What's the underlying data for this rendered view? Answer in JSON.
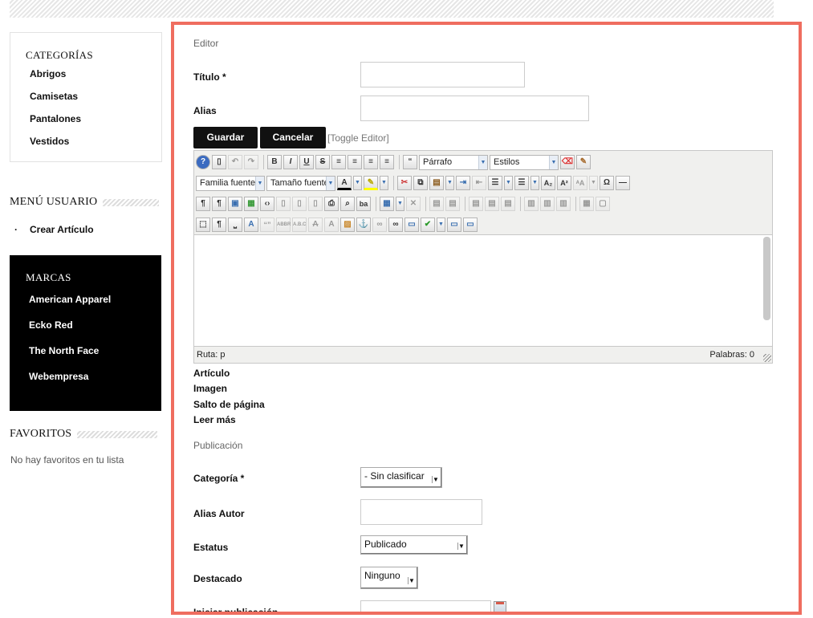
{
  "sidebar": {
    "categories_title": "CATEGORÍAS",
    "categories": [
      "Abrigos",
      "Camisetas",
      "Pantalones",
      "Vestidos"
    ],
    "user_menu_title": "MENÚ USUARIO",
    "user_menu_items": [
      "Crear Artículo"
    ],
    "brands_title": "MARCAS",
    "brands": [
      "American Apparel",
      "Ecko Red",
      "The North Face",
      "Webempresa"
    ],
    "favorites_title": "FAVORITOS",
    "favorites_empty": "No hay favoritos en tu lista"
  },
  "form": {
    "editor_legend": "Editor",
    "title_label": "Título *",
    "title_value": "",
    "alias_label": "Alias",
    "alias_value": "",
    "save_label": "Guardar",
    "cancel_label": "Cancelar",
    "toggle_editor": "[Toggle Editor]",
    "toolbar": {
      "format_select": "Párrafo",
      "styles_select": "Estilos",
      "font_family_select": "Familia fuente",
      "font_size_select": "Tamaño fuente"
    },
    "status_path": "Ruta:  p",
    "status_words": "Palabras: 0",
    "editor_buttons": [
      "Artículo",
      "Imagen",
      "Salto de página",
      "Leer más"
    ],
    "publication_legend": "Publicación",
    "category_label": "Categoría *",
    "category_value": "- Sin clasificar",
    "author_alias_label": "Alias Autor",
    "author_alias_value": "",
    "status_label": "Estatus",
    "status_value": "Publicado",
    "featured_label": "Destacado",
    "featured_value": "Ninguno",
    "publish_start_label": "Iniciar publicación",
    "publish_start_value": ""
  },
  "colors": {
    "frame_highlight": "#ef6d5f",
    "button_bg": "#111111",
    "brands_bg": "#000000"
  }
}
